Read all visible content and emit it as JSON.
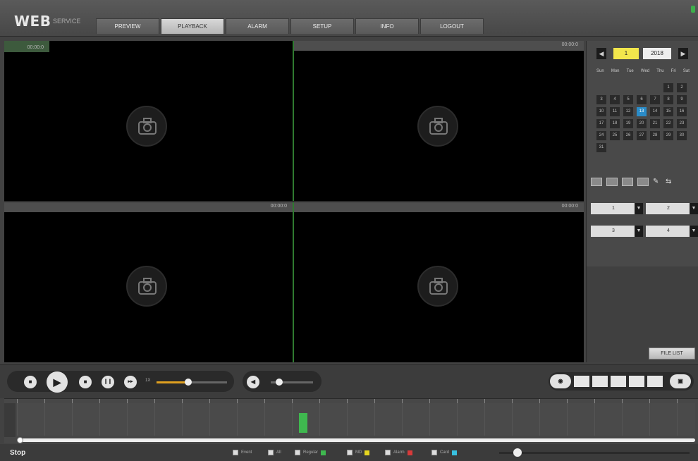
{
  "header": {
    "logo": "WEB",
    "logo_sub": "SERVICE",
    "tabs": [
      {
        "label": "PREVIEW",
        "active": true
      },
      {
        "label": "PLAYBACK",
        "active": false
      },
      {
        "label": "ALARM",
        "active": false
      },
      {
        "label": "SETUP",
        "active": false
      },
      {
        "label": "INFO",
        "active": false
      },
      {
        "label": "LOGOUT",
        "active": false
      }
    ]
  },
  "video": {
    "panes": [
      {
        "time": "00:00:0",
        "selected": true
      },
      {
        "time": "00:00:0",
        "selected": false
      },
      {
        "time": "00:00:0",
        "selected": false
      },
      {
        "time": "00:00:0",
        "selected": false
      }
    ],
    "placeholder_icon": "camera-icon"
  },
  "calendar": {
    "month": "1",
    "year": "2018",
    "prev_icon": "chevron-left-icon",
    "next_icon": "chevron-right-icon",
    "weekdays": [
      "Sun",
      "Mon",
      "Tue",
      "Wed",
      "Thu",
      "Fri",
      "Sat"
    ],
    "days": [
      "1",
      "2",
      "3",
      "4",
      "5",
      "6",
      "7",
      "8",
      "9",
      "10",
      "11",
      "12",
      "13",
      "14",
      "15",
      "16",
      "17",
      "18",
      "19",
      "20",
      "21",
      "22",
      "23",
      "24",
      "25",
      "26",
      "27",
      "28",
      "29",
      "30",
      "31"
    ],
    "first_weekday": 5,
    "today": "13"
  },
  "channels": [
    {
      "value": "1"
    },
    {
      "value": "2"
    },
    {
      "value": "3"
    },
    {
      "value": "4"
    }
  ],
  "right_panel": {
    "button_label": "FILE LIST"
  },
  "controls": {
    "speed_label": "1X",
    "speed_level": 0.45,
    "volume_level": 0.2
  },
  "status": {
    "text": "Stop",
    "legend": [
      {
        "label": "Event",
        "color": ""
      },
      {
        "label": "All",
        "color": ""
      },
      {
        "label": "Regular",
        "color": "#3fb84f"
      },
      {
        "label": "MD",
        "color": "#e6d620"
      },
      {
        "label": "Alarm",
        "color": "#d83a3a"
      },
      {
        "label": "Card",
        "color": "#38c0e0"
      }
    ]
  }
}
